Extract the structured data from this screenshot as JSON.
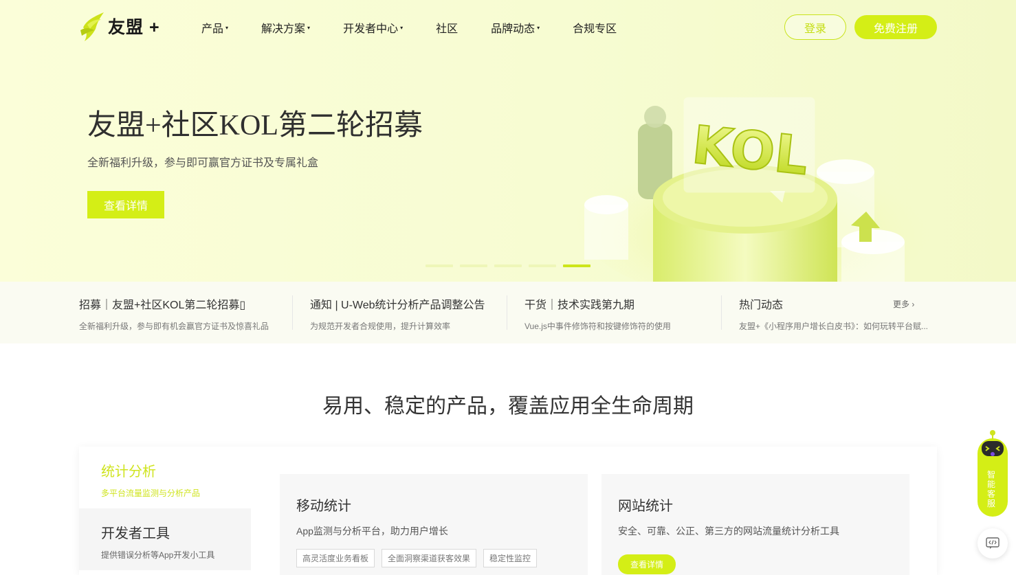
{
  "brand": {
    "name": "友盟 +",
    "accent": "#d4ee16"
  },
  "nav": {
    "items": [
      {
        "label": "产品",
        "has_dropdown": true
      },
      {
        "label": "解决方案",
        "has_dropdown": true
      },
      {
        "label": "开发者中心",
        "has_dropdown": true
      },
      {
        "label": "社区",
        "has_dropdown": false
      },
      {
        "label": "品牌动态",
        "has_dropdown": true
      },
      {
        "label": "合规专区",
        "has_dropdown": false
      }
    ],
    "caret": "▾",
    "login": "登录",
    "register": "免费注册"
  },
  "hero": {
    "title": "友盟+社区KOL第二轮招募",
    "subtitle": "全新福利升级，参与即可赢官方证书及专属礼盒",
    "button": "查看详情",
    "illustration_text": "KOL",
    "slides_total": 5,
    "active_slide": 5
  },
  "news": [
    {
      "title": "招募｜友盟+社区KOL第二轮招募▯",
      "desc": "全新福利升级，参与即有机会赢官方证书及惊喜礼品"
    },
    {
      "title": "通知 | U-Web统计分析产品调整公告",
      "desc": "为规范开发者合规使用，提升计算效率"
    },
    {
      "title": "干货｜技术实践第九期",
      "desc": "Vue.js中事件修饰符和按键修饰符的使用"
    },
    {
      "title": "热门动态",
      "desc": "友盟+《小程序用户增长白皮书》：如何玩转平台赋...",
      "more": "更多 ›"
    }
  ],
  "section": {
    "title": "易用、稳定的产品，覆盖应用全生命周期",
    "sidebar": [
      {
        "name": "统计分析",
        "desc": "多平台流量监测与分析产品",
        "active": true
      },
      {
        "name": "开发者工具",
        "desc": "提供错误分析等App开发小工具",
        "active": false
      }
    ],
    "cards": [
      {
        "title": "移动统计",
        "desc": "App监测与分析平台，助力用户增长",
        "tags": [
          "高灵活度业务看板",
          "全面洞察渠道获客效果",
          "稳定性监控"
        ]
      },
      {
        "title": "网站统计",
        "desc": "安全、可靠、公正、第三方的网站流量统计分析工具",
        "button": "查看详情"
      }
    ]
  },
  "float": {
    "bot_label": "智能客服"
  }
}
